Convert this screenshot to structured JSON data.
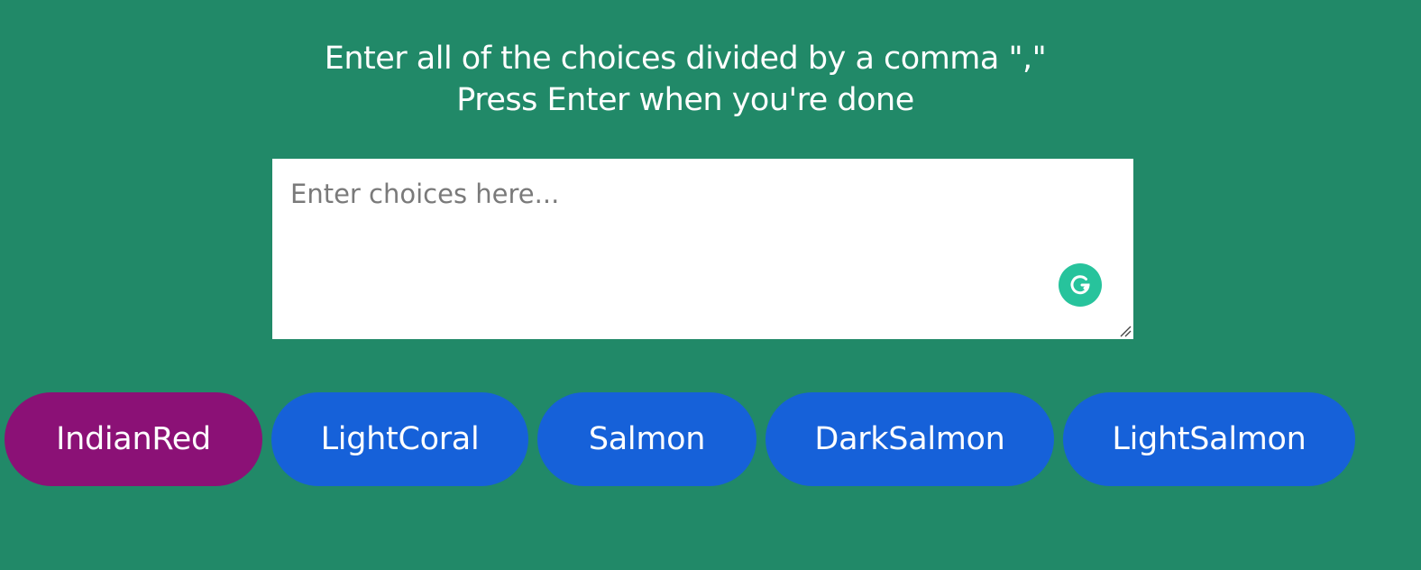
{
  "instructions": {
    "line1": "Enter all of the choices divided by a comma \",\"",
    "line2": "Press Enter when you're done"
  },
  "choices_input": {
    "placeholder": "Enter choices here...",
    "value": ""
  },
  "grammarly": {
    "icon": "grammarly-icon",
    "color": "#27c39c"
  },
  "tags": [
    {
      "label": "IndianRed",
      "color": "#8b1176",
      "highlighted": true
    },
    {
      "label": "LightCoral",
      "color": "#1661d9",
      "highlighted": false
    },
    {
      "label": "Salmon",
      "color": "#1661d9",
      "highlighted": false
    },
    {
      "label": "DarkSalmon",
      "color": "#1661d9",
      "highlighted": false
    },
    {
      "label": "LightSalmon",
      "color": "#1661d9",
      "highlighted": false
    }
  ],
  "colors": {
    "background": "#218968",
    "tag_default": "#1661d9",
    "tag_highlight": "#8b1176"
  }
}
